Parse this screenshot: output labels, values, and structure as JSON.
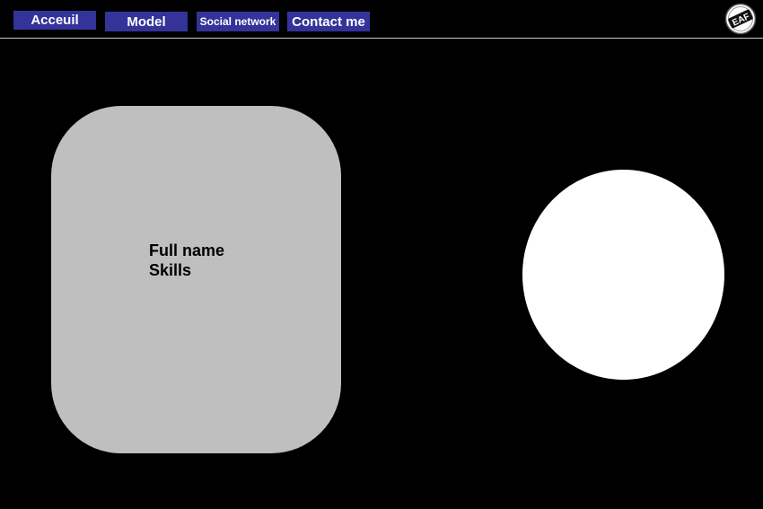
{
  "nav": {
    "items": [
      {
        "label": "Acceuil"
      },
      {
        "label": "Model"
      },
      {
        "label": "Social network"
      },
      {
        "label": "Contact me"
      }
    ],
    "button_color": "#33339a"
  },
  "logo": {
    "text": "EAF",
    "icon": "eaf-logo-icon"
  },
  "profile_card": {
    "full_name": "Full name",
    "skills": "Skills",
    "color": "#bfbfbf"
  },
  "photo_placeholder": {
    "color": "#ffffff"
  },
  "background_color": "#000000"
}
